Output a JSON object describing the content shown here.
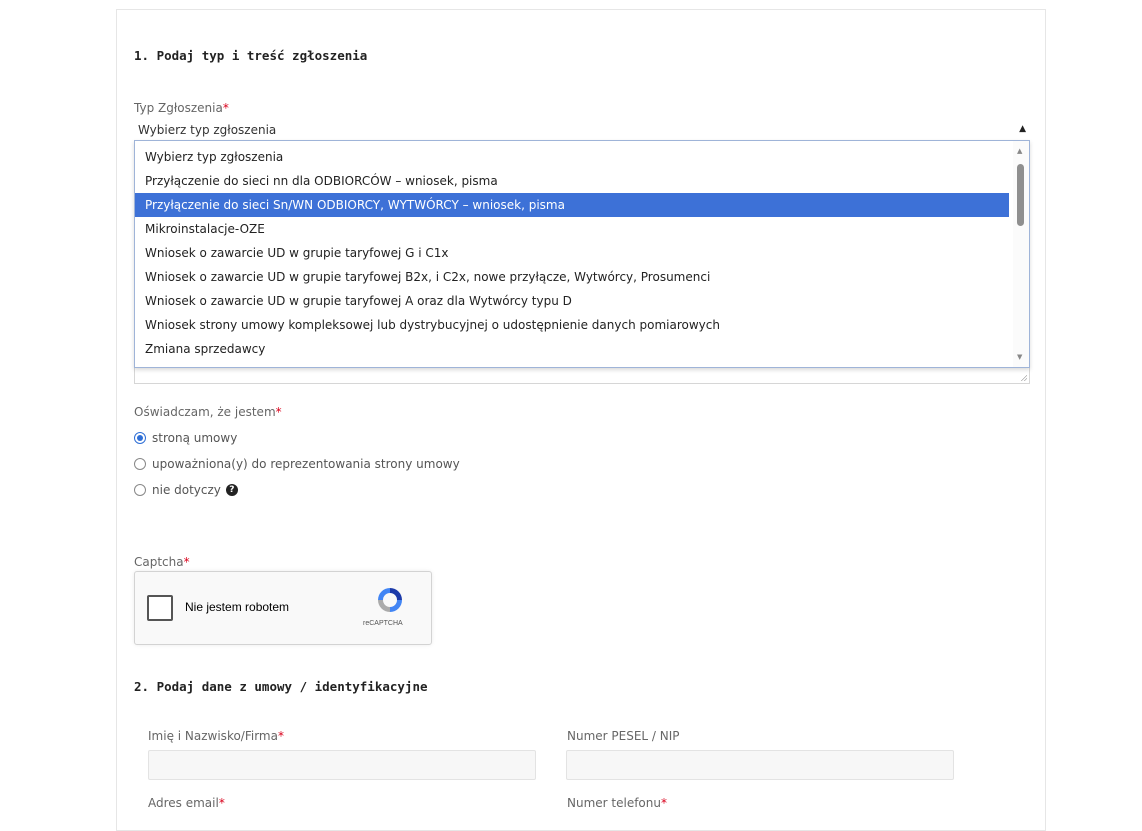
{
  "section1": {
    "heading": "1. Podaj typ i treść zgłoszenia",
    "type_label": "Typ Zgłoszenia",
    "required_mark": "*",
    "select_value": "Wybierz typ zgłoszenia",
    "options": [
      "Wybierz typ zgłoszenia",
      "Przyłączenie do sieci nn dla ODBIORCÓW – wniosek, pisma",
      "Przyłączenie do sieci Sn/WN ODBIORCY, WYTWÓRCY – wniosek, pisma",
      "Mikroinstalacje-OZE",
      "Wniosek o zawarcie UD w grupie taryfowej G i C1x",
      "Wniosek o zawarcie UD w grupie taryfowej B2x, i C2x, nowe przyłącze, Wytwórcy, Prosumenci",
      "Wniosek o zawarcie UD w grupie taryfowej A oraz dla Wytwórcy typu D",
      "Wniosek strony umowy kompleksowej lub dystrybucyjnej o udostępnienie danych pomiarowych",
      "Zmiana sprzedawcy"
    ],
    "selected_option_index": 2,
    "declaration_label": "Oświadczam, że jestem",
    "radio_options": [
      "stroną umowy",
      "upoważniona(y) do reprezentowania strony umowy",
      "nie dotyczy"
    ],
    "checked_radio_index": 0,
    "help_icon_glyph": "?",
    "captcha_label": "Captcha",
    "recaptcha": {
      "checkbox_label": "Nie jestem robotem",
      "brand": "reCAPTCHA"
    }
  },
  "section2": {
    "heading": "2. Podaj dane z umowy / identyfikacyjne",
    "name_label": "Imię i Nazwisko/Firma",
    "pesel_label": "Numer PESEL / NIP",
    "name_value": "",
    "pesel_value": "",
    "email_label": "Adres email",
    "phone_label": "Numer telefonu"
  },
  "colors": {
    "selected_option_bg": "#3d71d7",
    "required": "#d9001b",
    "radio_checked": "#2f6fd6"
  },
  "icons": {
    "select_arrow": "caret-up-icon",
    "help": "question-circle-icon",
    "recaptcha": "recaptcha-logo-icon"
  }
}
